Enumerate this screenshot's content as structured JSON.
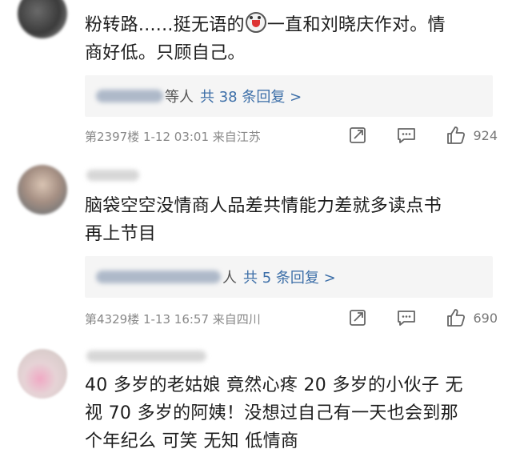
{
  "comments": [
    {
      "text_line1_a": "粉转路......挺无语的",
      "text_line1_b": "一直和刘晓庆作对。情",
      "text_line2": "商好低。只顾自己。",
      "emoji_icon": "shocked-face-icon",
      "reply_suffix": "等人",
      "reply_count": "共 38 条回复 >",
      "floor": "第2397楼",
      "time": "1-12 03:01",
      "location": "来自江苏",
      "likes": "924"
    },
    {
      "text_line1": "脑袋空空没情商人品差共情能力差就多读点书",
      "text_line2": "再上节目",
      "reply_suffix": "人",
      "reply_count": "共 5 条回复 >",
      "floor": "第4329楼",
      "time": "1-13 16:57",
      "location": "来自四川",
      "likes": "690"
    },
    {
      "text_line1": "40 多岁的老姑娘 竟然心疼 20 多岁的小伙子 无",
      "text_line2": "视 70 多岁的阿姨！没想过自己有一天也会到那",
      "text_line3": "个年纪么 可笑 无知 低情商"
    }
  ],
  "icons": {
    "share": "share-icon",
    "comment": "comment-icon",
    "like": "thumbs-up-icon"
  },
  "colors": {
    "link_blue": "#3d6fa8",
    "meta_gray": "#888888",
    "reply_bg": "#f5f5f5"
  }
}
